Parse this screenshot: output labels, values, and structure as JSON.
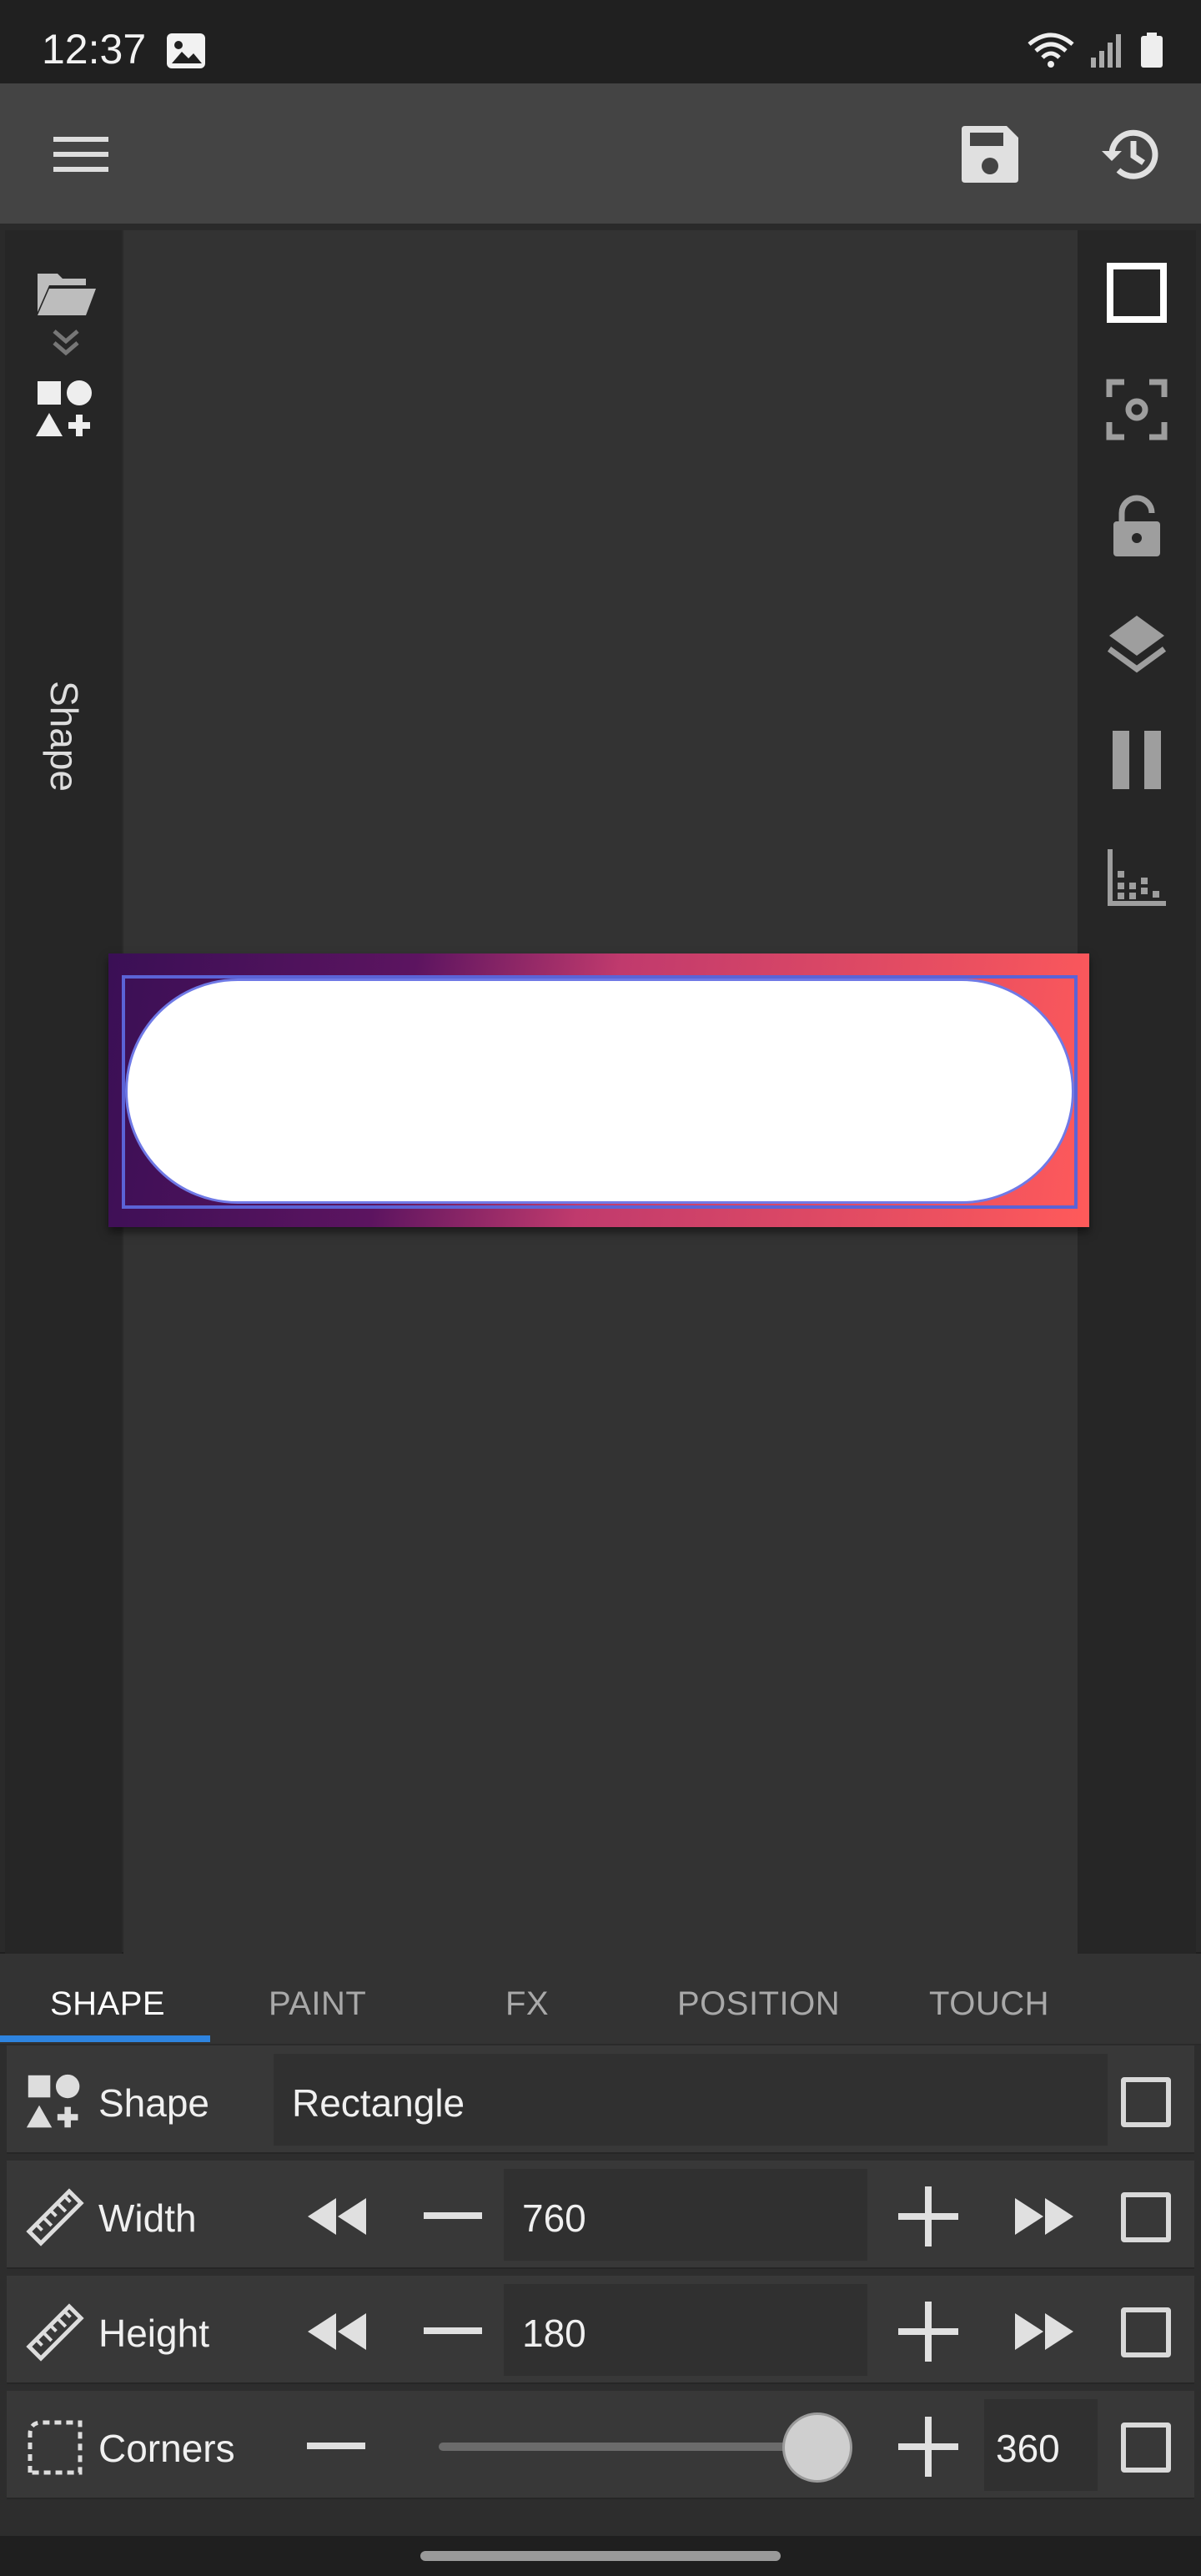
{
  "status_bar": {
    "time": "12:37",
    "icons": [
      "image-notification-icon",
      "wifi-icon",
      "signal-icon",
      "battery-icon"
    ]
  },
  "app_bar": {
    "menu_icon": "menu-icon",
    "save_icon": "save-icon",
    "history_icon": "history-icon"
  },
  "left_rail": {
    "open_icon": "folder-open-icon",
    "expand_icon": "chevron-double-down-icon",
    "shapes_icon": "shapes-icon",
    "label": "Shape"
  },
  "right_rail": {
    "icons": [
      "rectangle-icon",
      "focus-icon",
      "lock-icon",
      "layers-icon",
      "pause-icon",
      "chart-icon"
    ]
  },
  "canvas": {
    "gradient_colors": [
      "#3a0f55",
      "#c03a6d",
      "#ff5a5a"
    ],
    "selection_color": "#5b63d6"
  },
  "tabs": [
    {
      "label": "SHAPE",
      "active": true
    },
    {
      "label": "PAINT",
      "active": false
    },
    {
      "label": "FX",
      "active": false
    },
    {
      "label": "POSITION",
      "active": false
    },
    {
      "label": "TOUCH",
      "active": false
    }
  ],
  "properties": {
    "shape": {
      "label": "Shape",
      "value": "Rectangle"
    },
    "width": {
      "label": "Width",
      "value": "760"
    },
    "height": {
      "label": "Height",
      "value": "180"
    },
    "corners": {
      "label": "Corners",
      "value": "360",
      "slider_fraction": 1.0
    }
  },
  "accent_color": "#2e84e0"
}
